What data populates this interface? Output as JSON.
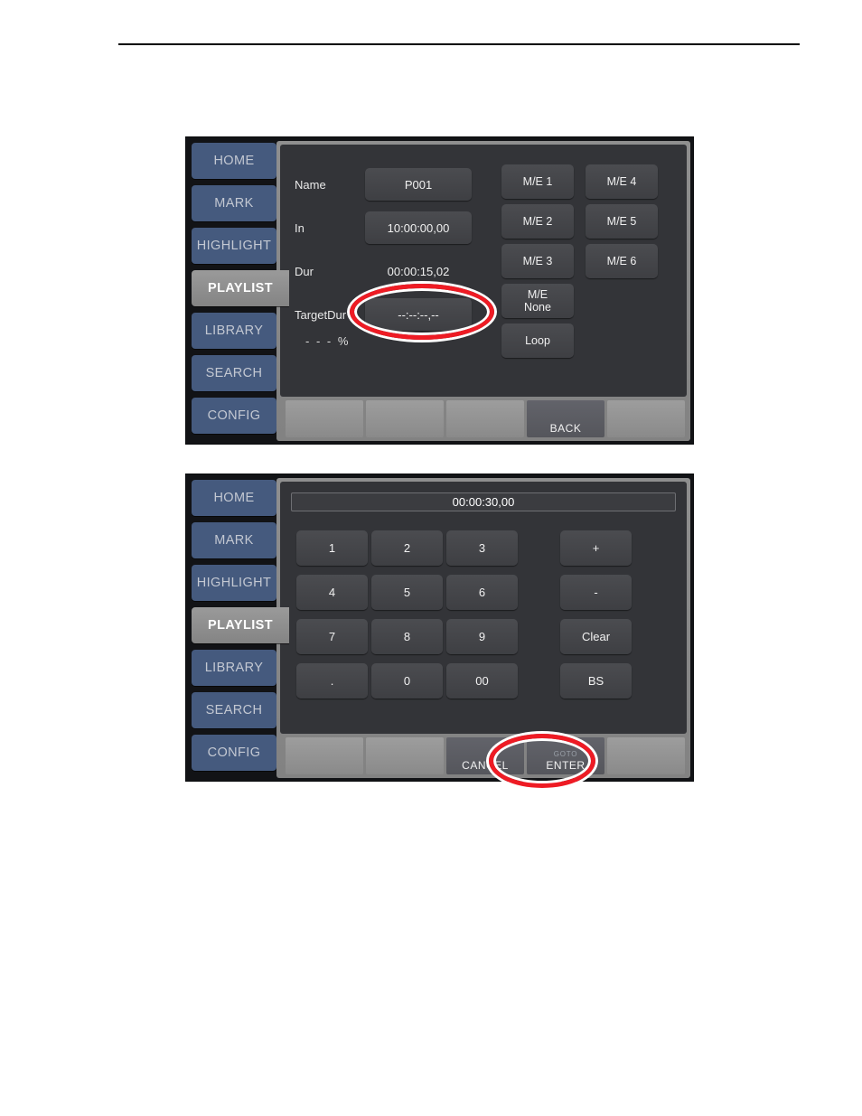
{
  "sidebar": {
    "items": [
      {
        "label": "HOME",
        "active": false
      },
      {
        "label": "MARK",
        "active": false
      },
      {
        "label": "HIGHLIGHT",
        "active": false
      },
      {
        "label": "PLAYLIST",
        "active": true
      },
      {
        "label": "LIBRARY",
        "active": false
      },
      {
        "label": "SEARCH",
        "active": false
      },
      {
        "label": "CONFIG",
        "active": false
      }
    ]
  },
  "colors": {
    "nav_inactive": "#455a7e",
    "nav_active": "#8d8d8d",
    "panel_background": "#333438",
    "button_face": "#45464a",
    "annotation_red": "#ee1b24"
  },
  "panel_one": {
    "form": [
      {
        "label": "Name",
        "value": "P001",
        "type": "button"
      },
      {
        "label": "In",
        "value": "10:00:00,00",
        "type": "button"
      },
      {
        "label": "Dur",
        "value": "00:00:15,02",
        "type": "static"
      },
      {
        "label": "TargetDur",
        "value": "--:--:--,--",
        "type": "button"
      }
    ],
    "percent": "- - -   %",
    "me_column_one": [
      "M/E 1",
      "M/E 2",
      "M/E 3",
      "M/E\nNone",
      "Loop"
    ],
    "me_column_two": [
      "M/E 4",
      "M/E 5",
      "M/E 6"
    ],
    "me_buttons": [
      {
        "label": "M/E 1"
      },
      {
        "label": "M/E 2"
      },
      {
        "label": "M/E 3"
      },
      {
        "label": "M/E None"
      },
      {
        "label": "Loop"
      },
      {
        "label": "M/E 4"
      },
      {
        "label": "M/E 5"
      },
      {
        "label": "M/E 6"
      }
    ],
    "softkeys": [
      {
        "sub": "",
        "main": ""
      },
      {
        "sub": "",
        "main": ""
      },
      {
        "sub": "",
        "main": ""
      },
      {
        "sub": "",
        "main": "BACK"
      },
      {
        "sub": "",
        "main": ""
      }
    ]
  },
  "panel_two": {
    "display": "00:00:30,00",
    "keys": [
      {
        "label": "1"
      },
      {
        "label": "2"
      },
      {
        "label": "3"
      },
      {
        "label": "+"
      },
      {
        "label": "4"
      },
      {
        "label": "5"
      },
      {
        "label": "6"
      },
      {
        "label": "-"
      },
      {
        "label": "7"
      },
      {
        "label": "8"
      },
      {
        "label": "9"
      },
      {
        "label": "Clear"
      },
      {
        "label": "."
      },
      {
        "label": "0"
      },
      {
        "label": "00"
      },
      {
        "label": "BS"
      }
    ],
    "softkeys": [
      {
        "sub": "",
        "main": ""
      },
      {
        "sub": "",
        "main": ""
      },
      {
        "sub": "",
        "main": "CANCEL"
      },
      {
        "sub": "GOTO",
        "main": "ENTER"
      },
      {
        "sub": "",
        "main": ""
      }
    ]
  },
  "me_labels": {
    "me_none_line1": "M/E",
    "me_none_line2": "None"
  }
}
